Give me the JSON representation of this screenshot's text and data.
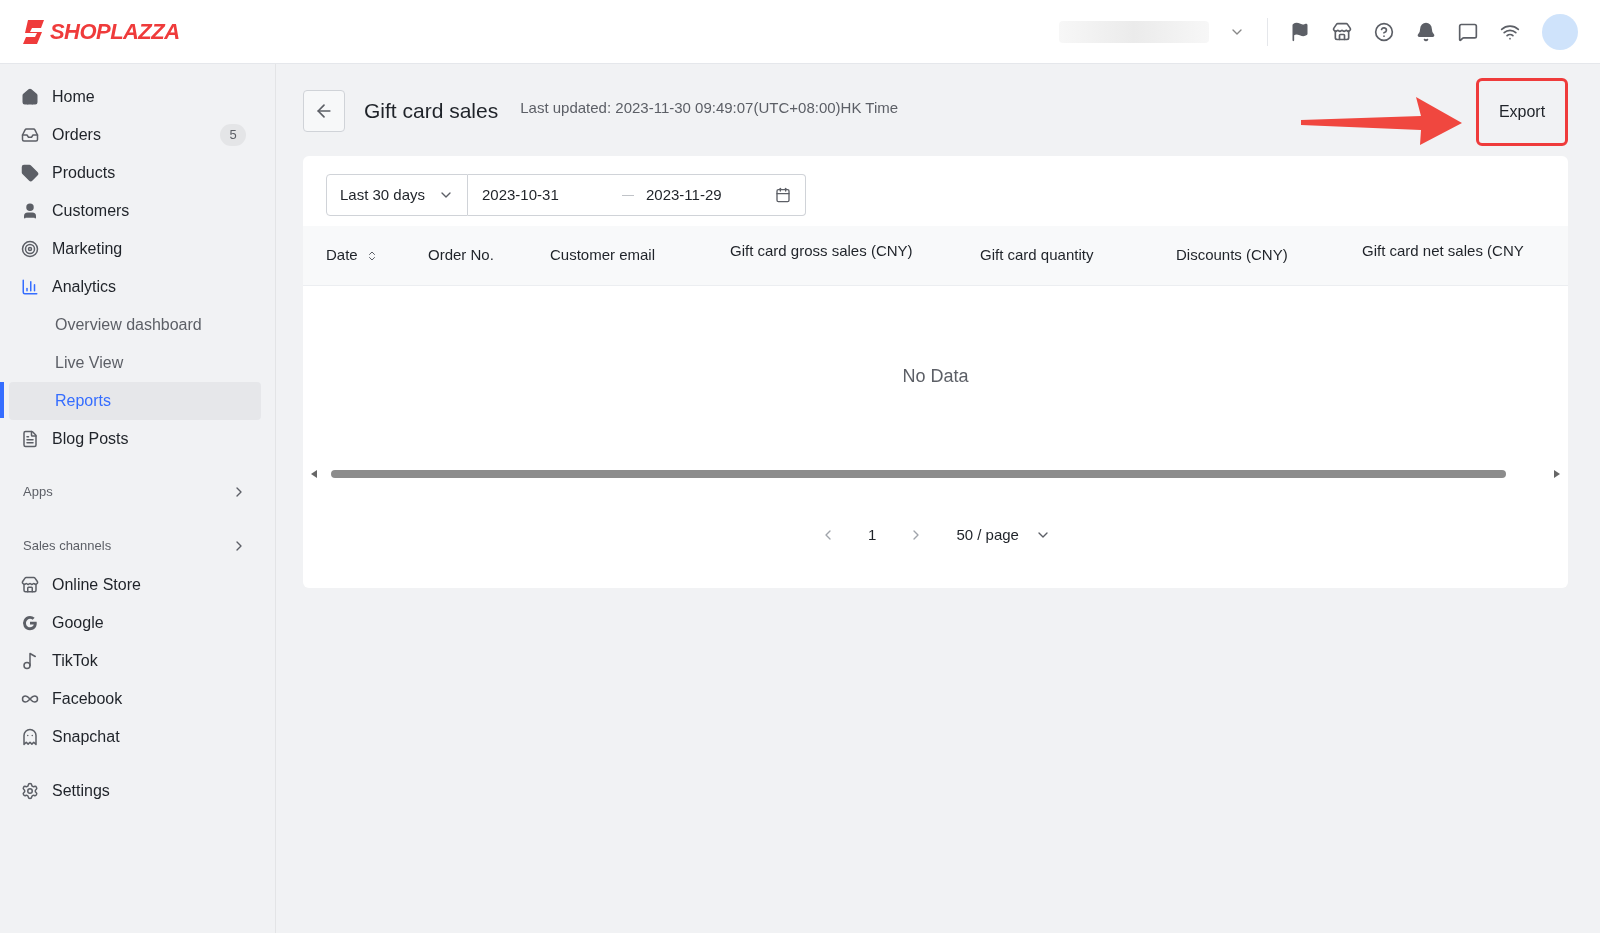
{
  "brand": {
    "name": "SHOPLAZZA"
  },
  "sidebar": {
    "items": [
      {
        "kind": "item",
        "label": "Home",
        "selected": false
      },
      {
        "kind": "item",
        "label": "Orders",
        "badge": "5",
        "selected": false
      },
      {
        "kind": "item",
        "label": "Products",
        "selected": false
      },
      {
        "kind": "item",
        "label": "Customers",
        "selected": false
      },
      {
        "kind": "item",
        "label": "Marketing",
        "selected": false
      },
      {
        "kind": "item",
        "label": "Analytics",
        "selected": true,
        "children": [
          {
            "label": "Overview dashboard",
            "selected": false
          },
          {
            "label": "Live View",
            "selected": false
          },
          {
            "label": "Reports",
            "selected": true
          }
        ]
      },
      {
        "kind": "item",
        "label": "Blog Posts",
        "selected": false
      },
      {
        "kind": "section",
        "label": "Apps"
      },
      {
        "kind": "section",
        "label": "Sales channels"
      },
      {
        "kind": "item",
        "label": "Online Store",
        "selected": false
      },
      {
        "kind": "item",
        "label": "Google",
        "selected": false
      },
      {
        "kind": "item",
        "label": "TikTok",
        "selected": false
      },
      {
        "kind": "item",
        "label": "Facebook",
        "selected": false
      },
      {
        "kind": "item",
        "label": "Snapchat",
        "selected": false
      },
      {
        "kind": "item",
        "label": "Settings",
        "selected": false
      }
    ]
  },
  "page": {
    "title": "Gift card sales",
    "last_updated": "Last updated: 2023-11-30 09:49:07(UTC+08:00)HK Time",
    "export_button": "Export"
  },
  "filters": {
    "range": "Last 30 days",
    "start_date": "2023-10-31",
    "end_date": "2023-11-29"
  },
  "table": {
    "columns": [
      {
        "label": "Date",
        "sortable": true
      },
      {
        "label": "Order No.",
        "sortable": false
      },
      {
        "label": "Customer email",
        "sortable": false
      },
      {
        "label": "Gift card gross sales (CNY)",
        "sortable": false
      },
      {
        "label": "Gift card quantity",
        "sortable": false
      },
      {
        "label": "Discounts (CNY)",
        "sortable": false
      },
      {
        "label": "Gift card net sales (CNY",
        "sortable": false
      }
    ],
    "empty_text": "No Data"
  },
  "pagination": {
    "pages": [
      {
        "label": "1",
        "selected": true
      }
    ],
    "page_size": "50 / page"
  }
}
